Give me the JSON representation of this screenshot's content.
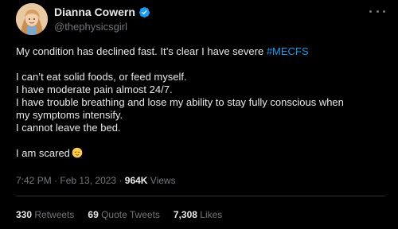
{
  "author": {
    "display_name": "Dianna Cowern",
    "handle": "@thephysicsgirl",
    "verified": true,
    "avatar_icon": "profile-photo",
    "verified_icon": "verified-badge-icon",
    "verified_color": "#1d9bf0"
  },
  "menu_icon": "more-options-icon",
  "tweet": {
    "line1_prefix": "My condition has declined fast. It’s clear I have severe ",
    "line1_hashtag": "#MECFS",
    "line2": "I can’t eat solid foods, or feed myself.",
    "line3": "I have moderate pain almost 24/7.",
    "line4": "I have trouble breathing and lose my ability to stay fully conscious when",
    "line5": "my symptoms intensify.",
    "line6": "I cannot leave the bed.",
    "line7": "I am scared",
    "emoji": "relieved-face-emoji"
  },
  "meta": {
    "time": "7:42 PM",
    "separator1": " · ",
    "date": "Feb 13, 2023",
    "separator2": " · ",
    "views_count": "964K",
    "views_label": " Views"
  },
  "stats": {
    "retweets_count": "330",
    "retweets_label": " Retweets",
    "quotes_count": "69",
    "quotes_label": " Quote Tweets",
    "likes_count": "7,308",
    "likes_label": " Likes"
  },
  "colors": {
    "background": "#000000",
    "text": "#e7e9ea",
    "secondary": "#71767b",
    "accent": "#1d9bf0",
    "divider": "#2f3336"
  }
}
